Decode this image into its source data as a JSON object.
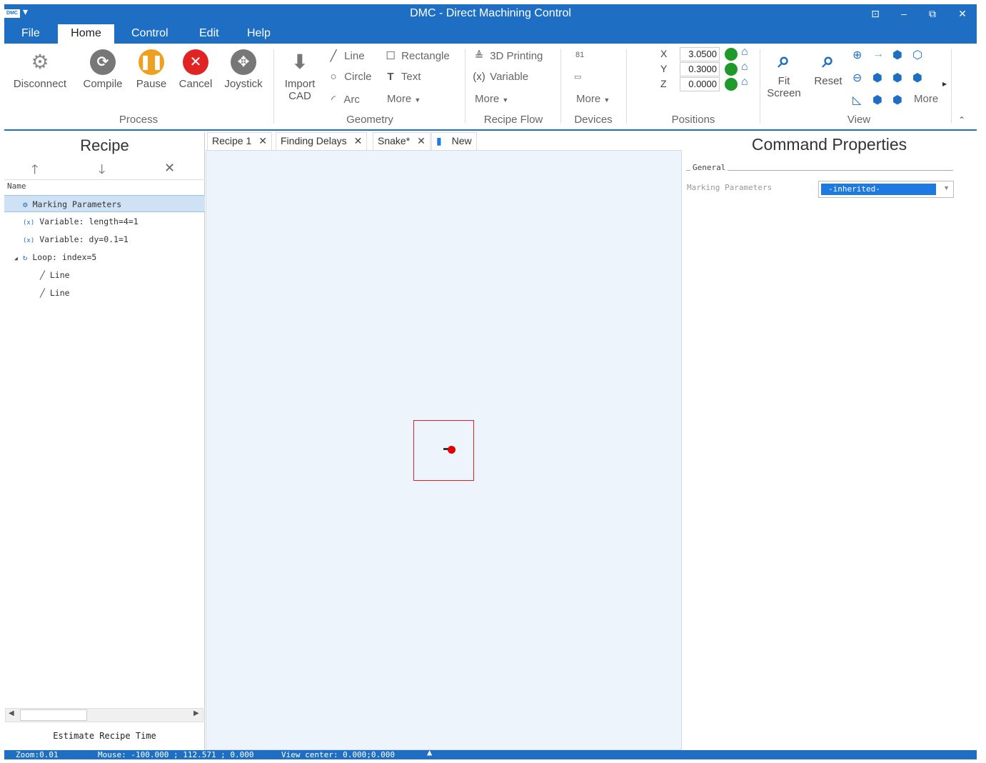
{
  "window": {
    "logo_text": "DMC",
    "quick_access": "▾",
    "title": "DMC - Direct Machining Control",
    "buttons": {
      "help": "⊡",
      "minimize": "–",
      "restore": "⧉",
      "close": "✕"
    }
  },
  "menu": {
    "tabs": [
      "File",
      "Home",
      "Control",
      "Edit",
      "Help"
    ],
    "active": "Home"
  },
  "ribbon": {
    "process": {
      "label": "Process",
      "disconnect": "Disconnect",
      "compile": "Compile",
      "pause": "Pause",
      "cancel": "Cancel",
      "joystick": "Joystick"
    },
    "import_cad": {
      "line1": "Import",
      "line2": "CAD"
    },
    "geometry": {
      "label": "Geometry",
      "line": "Line",
      "rectangle": "Rectangle",
      "circle": "Circle",
      "text": "Text",
      "arc": "Arc",
      "more": "More"
    },
    "recipe_flow": {
      "label": "Recipe Flow",
      "printing_3d": "3D Printing",
      "variable": "Variable",
      "more": "More"
    },
    "devices": {
      "label": "Devices",
      "item1": "81",
      "more": "More"
    },
    "positions": {
      "label": "Positions",
      "axes": [
        {
          "axis": "X",
          "value": "3.0500"
        },
        {
          "axis": "Y",
          "value": "0.3000"
        },
        {
          "axis": "Z",
          "value": "0.0000"
        }
      ]
    },
    "view": {
      "label": "View",
      "fit_line1": "Fit",
      "fit_line2": "Screen",
      "reset": "Reset",
      "more": "More"
    }
  },
  "recipe_panel": {
    "title": "Recipe",
    "column_header": "Name",
    "items": [
      {
        "label": "Marking Parameters",
        "icon": "gear-icon"
      },
      {
        "label": "Variable: length=4=1",
        "icon": "variable-icon"
      },
      {
        "label": "Variable: dy=0.1=1",
        "icon": "variable-icon"
      },
      {
        "label": "Loop: index=5",
        "icon": "loop-icon"
      },
      {
        "label": "Line",
        "icon": "line-icon"
      },
      {
        "label": "Line",
        "icon": "line-icon"
      }
    ],
    "estimate_button": "Estimate Recipe Time"
  },
  "doc_tabs": [
    {
      "label": "Recipe 1"
    },
    {
      "label": "Finding Delays"
    },
    {
      "label": "Snake*"
    },
    {
      "label": "New"
    }
  ],
  "properties": {
    "title": "Command Properties",
    "group": "General",
    "marking_label": "Marking Parameters",
    "marking_value": "-inherited-"
  },
  "status": {
    "zoom": "Zoom:0.01",
    "mouse": "Mouse: -100.000 ; 112.571 ; 0.000",
    "view_center": "View center: 0.000;0.000"
  },
  "colors": {
    "accent": "#1e6fc4",
    "canvas": "#eef4fb",
    "selected_row": "#cfe2f5"
  }
}
